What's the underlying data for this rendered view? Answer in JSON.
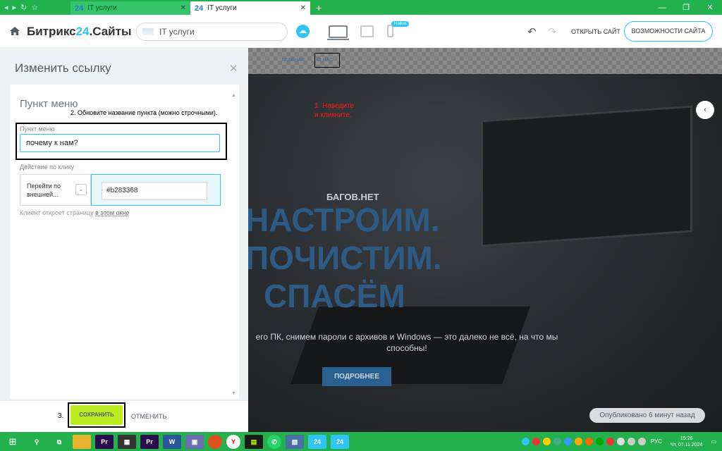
{
  "browser": {
    "tabs": [
      {
        "icon": "24",
        "title": "IT услуги",
        "active": false
      },
      {
        "icon": "24",
        "title": "IT услуги",
        "active": true
      }
    ]
  },
  "header": {
    "brand_prefix": "Битрикс",
    "brand_number": "24",
    "brand_suffix": ".Сайты",
    "site_name": "IT услуги",
    "badge_new": "Новое",
    "open_site": "ОТКРЫТЬ САЙТ",
    "features": "ВОЗМОЖНОСТИ САЙТА"
  },
  "panel": {
    "title": "Изменить ссылку",
    "card_title": "Пункт меню",
    "annotation_step2": "2. Обновите название пункта (можно строчными).",
    "menu_item_label": "Пункт меню",
    "menu_item_value": "почему к нам?",
    "action_label": "Действие по клику",
    "action_value": "Перейти по внешней...",
    "url_value": "#b283368",
    "hint_prefix": "Клиент откроет страницу",
    "hint_link": "в этом окне"
  },
  "savebar": {
    "step3": "3.",
    "save": "СОХРАНИТЬ",
    "cancel": "ОТМЕНИТЬ"
  },
  "preview": {
    "nav_main": "ГЛАВНАЯ",
    "nav_about": "О НАС",
    "annotation_step1_line1": "1. Наведите",
    "annotation_step1_line2": "и кликните.",
    "hero_small": "БАГОВ.НЕТ",
    "hero_line1": "НАСТРОИМ.",
    "hero_line2": "ПОЧИСТИМ.",
    "hero_line3": "СПАСЁМ",
    "hero_sub": "его ПК, снимем пароли с архивов и Windows — это далеко не всё, на что мы способны!",
    "more": "ПОДРОБНЕЕ",
    "published": "Опубликовано 6 минут назад"
  },
  "taskbar": {
    "lang": "РУС",
    "time": "15:26",
    "date": "Чт, 07.11.2024"
  },
  "colors": {
    "accent": "#2fc6f6",
    "save": "#bbed21",
    "taskbar": "#22b14c",
    "hero_text": "#2e5b86"
  }
}
